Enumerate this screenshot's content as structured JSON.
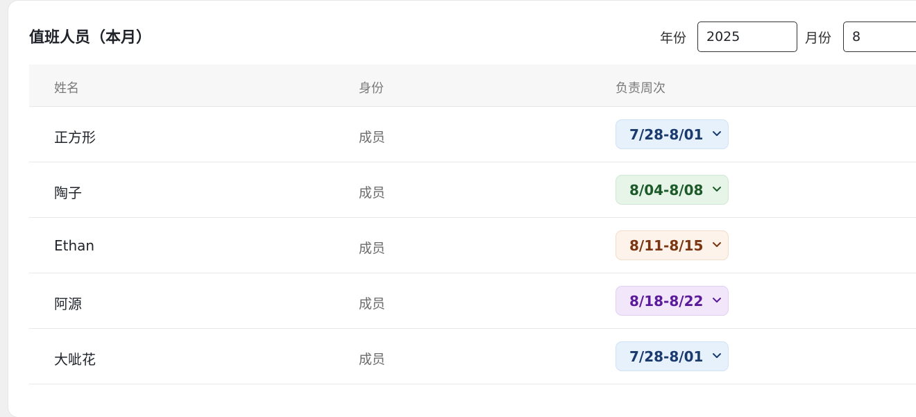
{
  "header": {
    "title": "值班人员（本月）",
    "year_label": "年份",
    "year_value": "2025",
    "month_label": "月份",
    "month_value": "8"
  },
  "table": {
    "columns": [
      "姓名",
      "身份",
      "负责周次"
    ],
    "rows": [
      {
        "name": "正方形",
        "role": "成员",
        "week": "7/28-8/01",
        "color": "blue"
      },
      {
        "name": "陶子",
        "role": "成员",
        "week": "8/04-8/08",
        "color": "green"
      },
      {
        "name": "Ethan",
        "role": "成员",
        "week": "8/11-8/15",
        "color": "orange"
      },
      {
        "name": "阿源",
        "role": "成员",
        "week": "8/18-8/22",
        "color": "purple"
      },
      {
        "name": "大呲花",
        "role": "成员",
        "week": "7/28-8/01",
        "color": "blue"
      }
    ]
  },
  "colors": {
    "blue": {
      "bg": "#e6f1fc",
      "border": "#cfe2f6",
      "text": "#1a3a6e"
    },
    "green": {
      "bg": "#e6f5e8",
      "border": "#cfe8d3",
      "text": "#1d5a2a"
    },
    "orange": {
      "bg": "#fdf3ea",
      "border": "#f3dcc8",
      "text": "#7a3512"
    },
    "purple": {
      "bg": "#f2e6fb",
      "border": "#e2cff3",
      "text": "#5a1a9a"
    }
  }
}
